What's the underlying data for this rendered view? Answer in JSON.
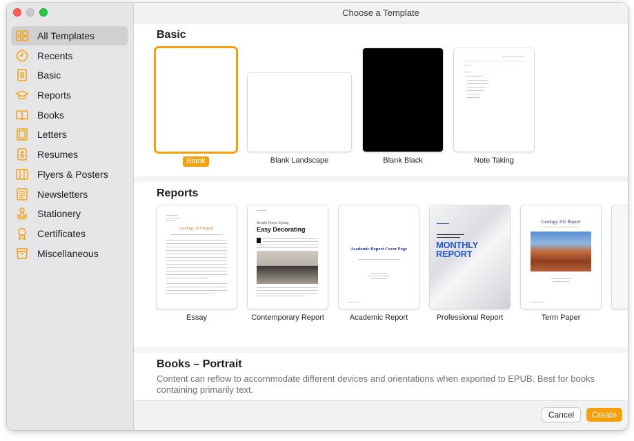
{
  "window": {
    "title": "Choose a Template"
  },
  "colors": {
    "accent": "#f59f0b",
    "sidebar_icon": "#f59f0b"
  },
  "sidebar": {
    "items": [
      {
        "label": "All Templates",
        "icon": "grid-icon",
        "active": true
      },
      {
        "label": "Recents",
        "icon": "clock-icon"
      },
      {
        "label": "Basic",
        "icon": "document-icon"
      },
      {
        "label": "Reports",
        "icon": "graduation-cap-icon"
      },
      {
        "label": "Books",
        "icon": "book-icon"
      },
      {
        "label": "Letters",
        "icon": "letter-icon"
      },
      {
        "label": "Resumes",
        "icon": "resume-icon"
      },
      {
        "label": "Flyers & Posters",
        "icon": "flyer-icon"
      },
      {
        "label": "Newsletters",
        "icon": "newsletter-icon"
      },
      {
        "label": "Stationery",
        "icon": "stamp-icon"
      },
      {
        "label": "Certificates",
        "icon": "ribbon-icon"
      },
      {
        "label": "Miscellaneous",
        "icon": "drawer-icon"
      }
    ]
  },
  "basic": {
    "title": "Basic",
    "templates": [
      {
        "label": "Blank",
        "selected": true
      },
      {
        "label": "Blank Landscape"
      },
      {
        "label": "Blank Black"
      },
      {
        "label": "Note Taking"
      }
    ]
  },
  "reports": {
    "title": "Reports",
    "templates": [
      {
        "label": "Essay",
        "thumb_title": "Geology 101 Report"
      },
      {
        "label": "Contemporary Report",
        "thumb_kicker": "Simple Home Styling",
        "thumb_title": "Easy Decorating"
      },
      {
        "label": "Academic Report",
        "thumb_title": "Academic Report Cover Page"
      },
      {
        "label": "Professional Report",
        "thumb_title": "MONTHLY REPORT"
      },
      {
        "label": "Term Paper",
        "thumb_title": "Geology 101 Report"
      }
    ]
  },
  "books": {
    "title": "Books – Portrait",
    "description": "Content can reflow to accommodate different devices and orientations when exported to EPUB. Best for books containing primarily text."
  },
  "footer": {
    "cancel_label": "Cancel",
    "create_label": "Create"
  }
}
